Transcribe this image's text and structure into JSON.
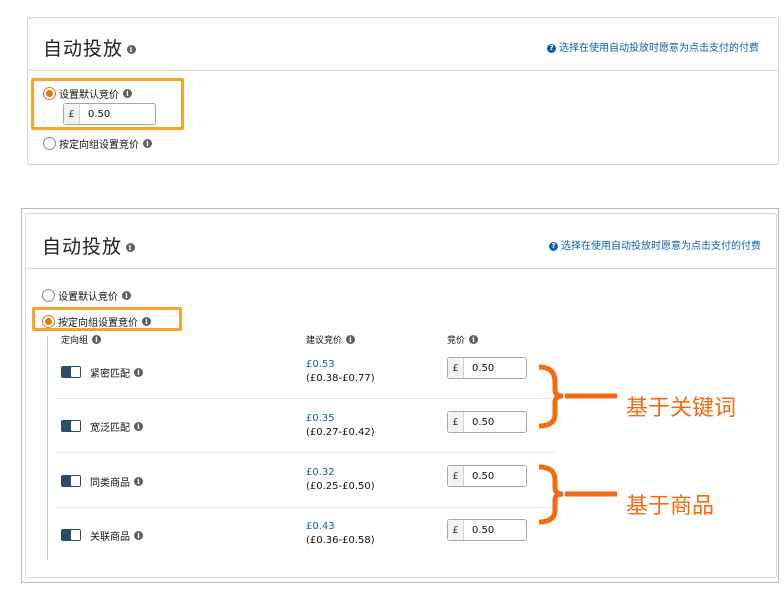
{
  "top_panel": {
    "title": "自动投放",
    "help_text": "选择在使用自动投放时愿意为点击支付的付费",
    "options": [
      {
        "label": "设置默认竞价",
        "selected": true
      },
      {
        "label": "按定向组设置竞价",
        "selected": false
      }
    ],
    "default_bid": {
      "currency": "£",
      "value": "0.50"
    }
  },
  "bottom_panel": {
    "title": "自动投放",
    "help_text": "选择在使用自动投放时愿意为点击支付的付费",
    "options": [
      {
        "label": "设置默认竞价",
        "selected": false
      },
      {
        "label": "按定向组设置竞价",
        "selected": true
      }
    ],
    "columns": {
      "target_group": "定向组",
      "suggested_bid": "建议竞价",
      "bid": "竞价"
    },
    "rows": [
      {
        "name": "紧密匹配",
        "enabled": true,
        "suggested": "£0.53",
        "range": "(£0.38-£0.77)",
        "currency": "£",
        "bid": "0.50"
      },
      {
        "name": "宽泛匹配",
        "enabled": true,
        "suggested": "£0.35",
        "range": "(£0.27-£0.42)",
        "currency": "£",
        "bid": "0.50"
      },
      {
        "name": "同类商品",
        "enabled": true,
        "suggested": "£0.32",
        "range": "(£0.25-£0.50)",
        "currency": "£",
        "bid": "0.50"
      },
      {
        "name": "关联商品",
        "enabled": true,
        "suggested": "£0.43",
        "range": "(£0.36-£0.58)",
        "currency": "£",
        "bid": "0.50"
      }
    ]
  },
  "annotations": {
    "keyword_based": "基于关键词",
    "product_based": "基于商品",
    "color": "#f36a10",
    "highlight_color": "#f7a229"
  },
  "info_glyph": "i",
  "help_glyph": "?"
}
